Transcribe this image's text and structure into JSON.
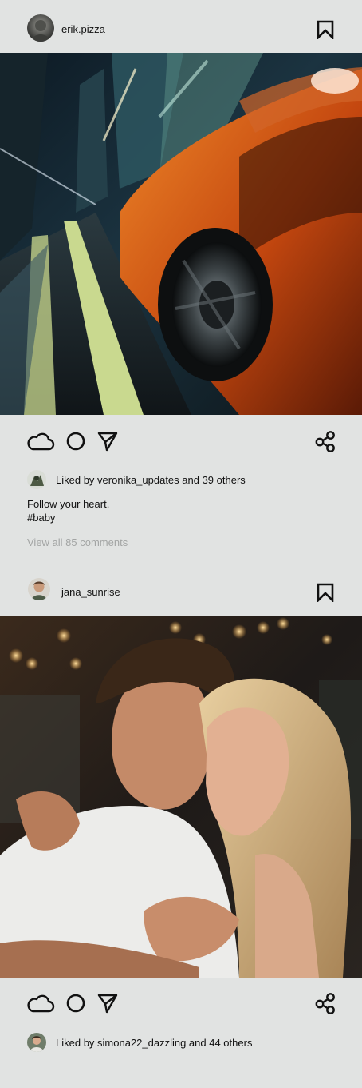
{
  "colors": {
    "background": "#e1e3e2",
    "text": "#111111",
    "muted_text": "#a3a5a4"
  },
  "posts": [
    {
      "username": "erik.pizza",
      "likes_text": "Liked by veronika_updates and 39 others",
      "caption_lines": [
        "Follow your heart.",
        "#baby"
      ],
      "view_comments": "View all 85 comments",
      "icons": [
        "bookmark-icon",
        "cloud-icon",
        "circle-icon",
        "send-icon",
        "share-icon"
      ]
    },
    {
      "username": "jana_sunrise",
      "likes_text": "Liked by simona22_dazzling and 44 others",
      "icons": [
        "bookmark-icon",
        "cloud-icon",
        "circle-icon",
        "send-icon",
        "share-icon"
      ]
    }
  ]
}
